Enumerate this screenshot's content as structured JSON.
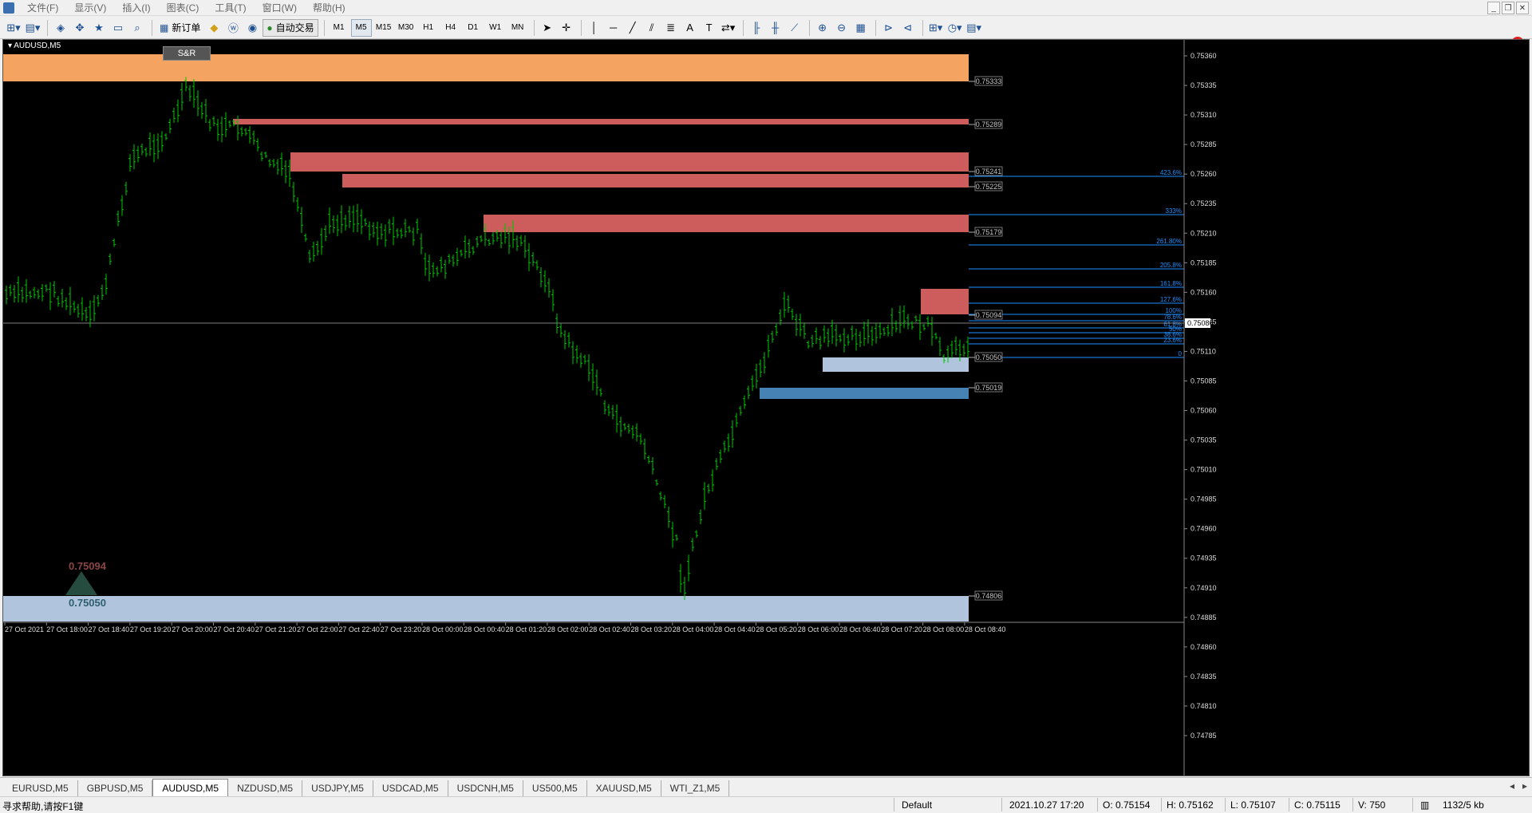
{
  "menu": {
    "items": [
      "文件(F)",
      "显示(V)",
      "插入(I)",
      "图表(C)",
      "工具(T)",
      "窗口(W)",
      "帮助(H)"
    ]
  },
  "toolbar": {
    "new_order": "新订单",
    "auto_trading": "自动交易",
    "timeframes": [
      "M1",
      "M5",
      "M15",
      "M30",
      "H1",
      "H4",
      "D1",
      "W1",
      "MN"
    ],
    "active_timeframe": "M5",
    "notifications": "1"
  },
  "chart": {
    "symbol": "AUDUSD,M5",
    "sr_button": "S&R",
    "price_ticks": [
      "0.75360",
      "0.75335",
      "0.75310",
      "0.75285",
      "0.75260",
      "0.75235",
      "0.75210",
      "0.75185",
      "0.75160",
      "0.75135",
      "0.75110",
      "0.75085",
      "0.75060",
      "0.75035",
      "0.75010",
      "0.74985",
      "0.74960",
      "0.74935",
      "0.74910",
      "0.74885",
      "0.74860",
      "0.74835",
      "0.74810",
      "0.74785"
    ],
    "time_ticks": [
      "27 Oct 2021",
      "27 Oct 18:00",
      "27 Oct 18:40",
      "27 Oct 19:20",
      "27 Oct 20:00",
      "27 Oct 20:40",
      "27 Oct 21:20",
      "27 Oct 22:00",
      "27 Oct 22:40",
      "27 Oct 23:20",
      "28 Oct 00:00",
      "28 Oct 00:40",
      "28 Oct 01:20",
      "28 Oct 02:00",
      "28 Oct 02:40",
      "28 Oct 03:20",
      "28 Oct 04:00",
      "28 Oct 04:40",
      "28 Oct 05:20",
      "28 Oct 06:00",
      "28 Oct 06:40",
      "28 Oct 07:20",
      "28 Oct 08:00",
      "28 Oct 08:40"
    ],
    "current_price": "0.75086",
    "level_labels": [
      "0.75333",
      "0.75289",
      "0.75241",
      "0.75225",
      "0.75179",
      "0.75094",
      "0.75050",
      "0.75019",
      "0.74806"
    ],
    "fib_labels": [
      "423.6%",
      "333%",
      "261.80%",
      "205.8%",
      "161.8%",
      "127.6%",
      "100%",
      "78.6%",
      "61.8%",
      "50%",
      "38.6%",
      "23.6%",
      "0"
    ],
    "indicator_values": {
      "upper": "0.75094",
      "lower": "0.75050"
    },
    "colors": {
      "supply_light": "#f4a460",
      "supply": "#cd5c5c",
      "demand_light": "#b0c4de",
      "demand": "#4682b4",
      "candles": "#00c800",
      "fib": "#1e90ff"
    }
  },
  "tabs": {
    "items": [
      "EURUSD,M5",
      "GBPUSD,M5",
      "AUDUSD,M5",
      "NZDUSD,M5",
      "USDJPY,M5",
      "USDCAD,M5",
      "USDCNH,M5",
      "US500,M5",
      "XAUUSD,M5",
      "WTI_Z1,M5"
    ],
    "active": "AUDUSD,M5"
  },
  "status": {
    "help": "寻求帮助,请按F1键",
    "profile": "Default",
    "datetime": "2021.10.27 17:20",
    "open": "O: 0.75154",
    "high": "H: 0.75162",
    "low": "L: 0.75107",
    "close": "C: 0.75115",
    "volume": "V: 750",
    "traffic": "1132/5 kb"
  }
}
